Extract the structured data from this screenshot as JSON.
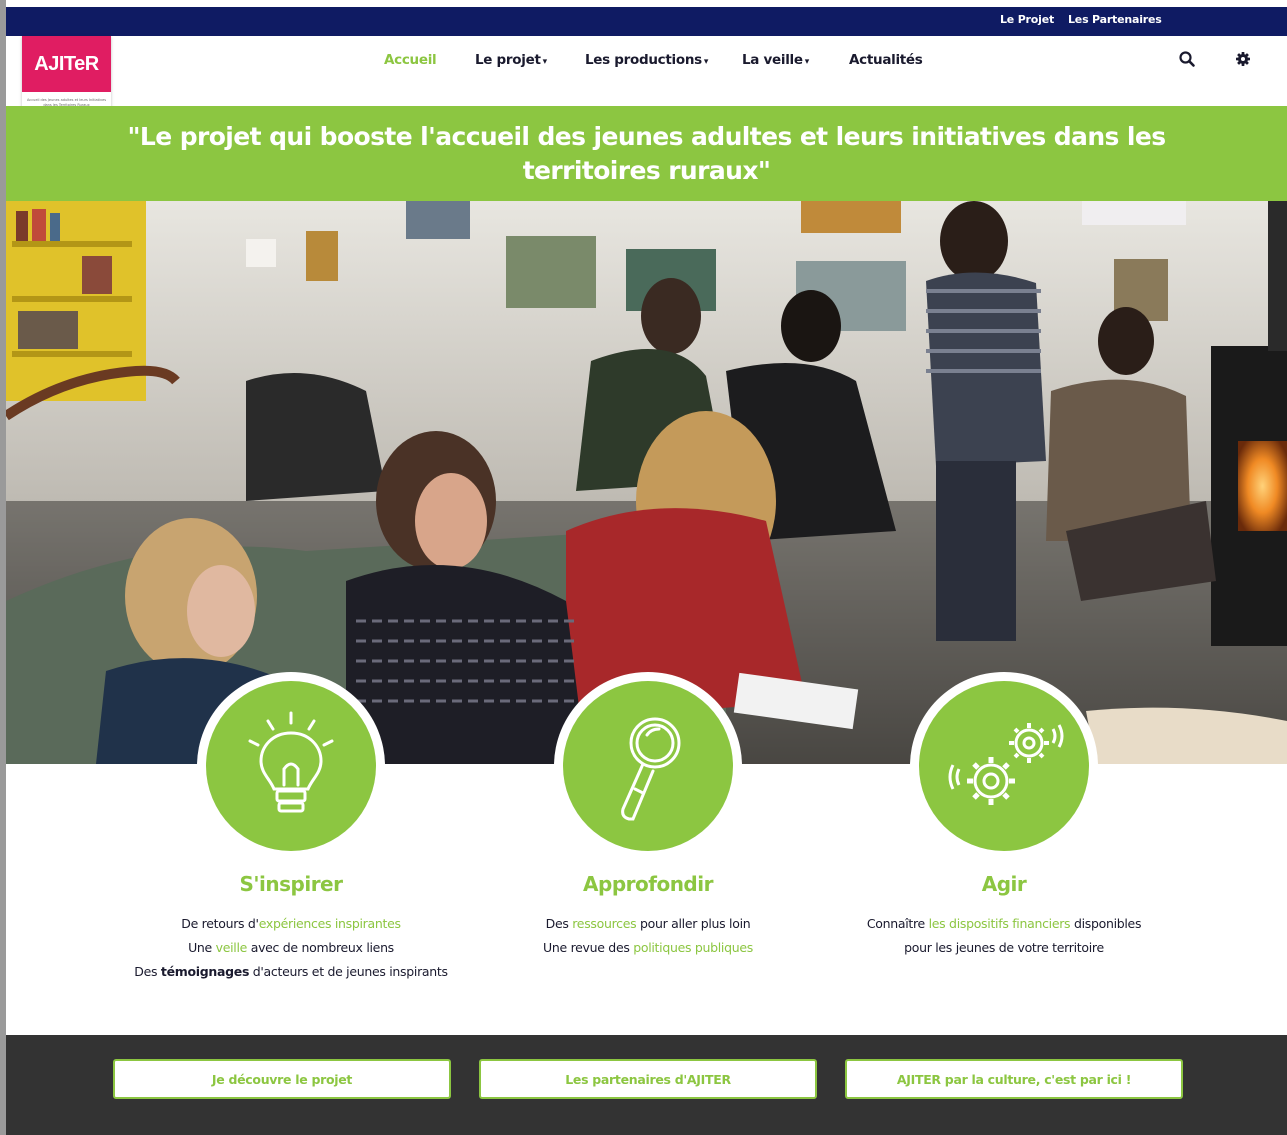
{
  "topbar": {
    "links": [
      "Le Projet",
      "Les Partenaires"
    ]
  },
  "logo": {
    "text": "AJITeR",
    "tagline": "Accueil des Jeunes adultes et leurs Initiatives dans les Territoires Ruraux"
  },
  "nav": {
    "items": [
      {
        "label": "Accueil",
        "active": true
      },
      {
        "label": "Le projet",
        "dropdown": true
      },
      {
        "label": "Les productions",
        "dropdown": true
      },
      {
        "label": "La veille",
        "dropdown": true
      },
      {
        "label": "Actualités"
      }
    ],
    "icons": [
      "search-icon",
      "gear-icon"
    ]
  },
  "banner": {
    "line1": "\"Le projet qui booste l'accueil des jeunes adultes et leurs initiatives dans les",
    "line2": "territoires ruraux\""
  },
  "features": [
    {
      "icon": "lightbulb-icon",
      "title": "S'inspirer",
      "lines": [
        [
          {
            "t": "De retours d'"
          },
          {
            "t": "expériences inspirantes",
            "hl": true
          }
        ],
        [
          {
            "t": "Une "
          },
          {
            "t": "veille",
            "hl": true
          },
          {
            "t": " avec de nombreux liens"
          }
        ],
        [
          {
            "t": "Des "
          },
          {
            "t": "témoignages",
            "b": true
          },
          {
            "t": " d'acteurs et de jeunes inspirants"
          }
        ]
      ]
    },
    {
      "icon": "magnifier-icon",
      "title": "Approfondir",
      "lines": [
        [
          {
            "t": "Des "
          },
          {
            "t": "ressources",
            "hl": true
          },
          {
            "t": " pour aller plus loin"
          }
        ],
        [
          {
            "t": "Une revue des "
          },
          {
            "t": "politiques publiques",
            "hl": true
          }
        ]
      ]
    },
    {
      "icon": "gears-icon",
      "title": "Agir",
      "lines": [
        [
          {
            "t": "Connaître "
          },
          {
            "t": "les dispositifs financiers",
            "hl": true
          },
          {
            "t": " disponibles"
          }
        ],
        [
          {
            "t": "pour les jeunes de votre territoire"
          }
        ]
      ]
    }
  ],
  "footer": {
    "buttons": [
      "Je découvre le projet",
      "Les partenaires d'AJITER",
      "AJITER par la culture, c'est par ici !"
    ]
  },
  "colors": {
    "accent": "#8cc641",
    "navy": "#0f1b63",
    "logo": "#e01d62",
    "footer": "#333333"
  }
}
